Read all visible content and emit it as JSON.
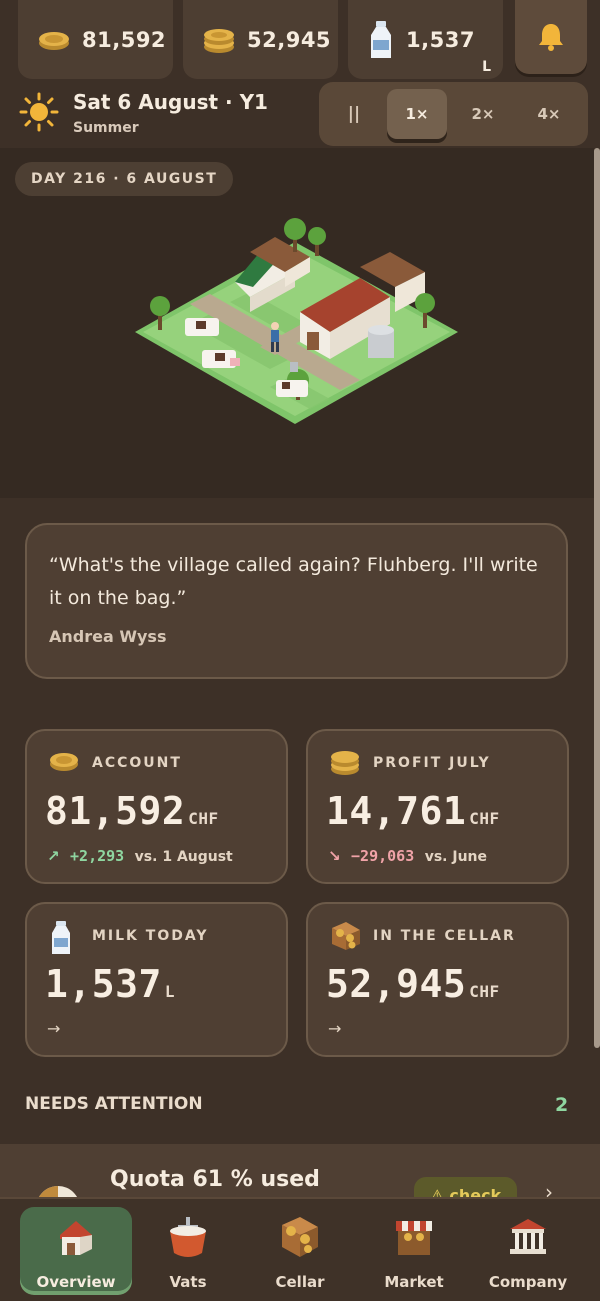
{
  "resources": {
    "account": "81,592",
    "cellar_value": "52,945",
    "milk": "1,537",
    "milk_unit": "L",
    "icons": [
      "coin-icon",
      "coin-stack-icon",
      "milk-bottle-icon",
      "bell-icon"
    ]
  },
  "date": {
    "title": "Sat 6 August · Y1",
    "season": "Summer",
    "icon": "sun-icon"
  },
  "speed": {
    "pause": "||",
    "options": [
      "1×",
      "2×",
      "4×"
    ],
    "selected": "1×"
  },
  "scene": {
    "day_label": "DAY 216 · 6 AUGUST"
  },
  "quote": {
    "text": "“What's the village called again? Fluhberg. I'll write it on the bag.”",
    "author": "Andrea Wyss"
  },
  "cards": {
    "account": {
      "label": "ACCOUNT",
      "value": "81,592",
      "unit": "CHF",
      "delta_arrow": "↗",
      "delta": "+2,293",
      "delta_note": "vs. 1 August"
    },
    "profit": {
      "label": "PROFIT JULY",
      "value": "14,761",
      "unit": "CHF",
      "delta_arrow": "↘",
      "delta": "−29,063",
      "delta_note": "vs. June"
    },
    "milk": {
      "label": "MILK TODAY",
      "value": "1,537",
      "unit": "L",
      "arrow": "→"
    },
    "cellar": {
      "label": "IN THE CELLAR",
      "value": "52,945",
      "unit": "CHF",
      "arrow": "→"
    }
  },
  "needs_attention": {
    "title": "NEEDS ATTENTION",
    "count": "2",
    "first_item": {
      "title": "Quota 61 % used",
      "action": "check",
      "action_icon": "warning-icon",
      "chevron": "›"
    }
  },
  "nav": {
    "items": [
      {
        "label": "Overview",
        "icon": "farmhouse-icon",
        "active": true
      },
      {
        "label": "Vats",
        "icon": "vat-icon",
        "active": false
      },
      {
        "label": "Cellar",
        "icon": "cheese-shelf-icon",
        "active": false
      },
      {
        "label": "Market",
        "icon": "market-stall-icon",
        "active": false
      },
      {
        "label": "Company",
        "icon": "bank-building-icon",
        "active": false
      }
    ]
  },
  "colors": {
    "background": "#3d3027",
    "card": "#4f3f33",
    "positive": "#8fd6a0",
    "negative": "#f0a3a8",
    "active_nav": "#4a6b4a"
  }
}
